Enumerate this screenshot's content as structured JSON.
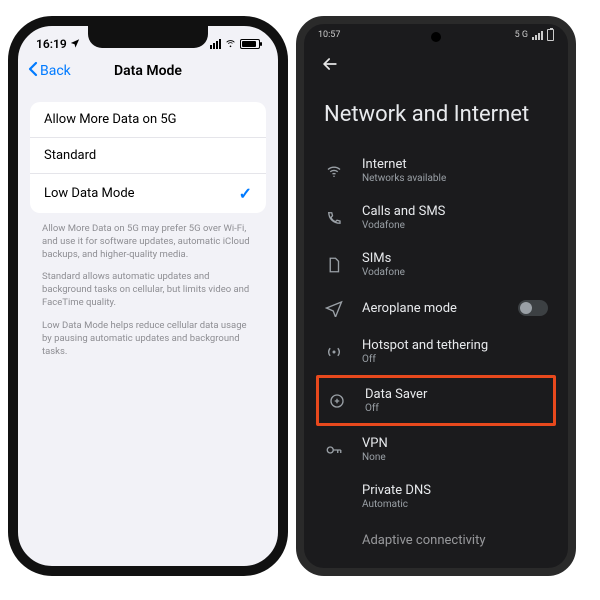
{
  "ios": {
    "status": {
      "time": "16:19"
    },
    "nav": {
      "back": "Back",
      "title": "Data Mode"
    },
    "options": [
      {
        "label": "Allow More Data on 5G",
        "selected": false
      },
      {
        "label": "Standard",
        "selected": false
      },
      {
        "label": "Low Data Mode",
        "selected": true
      }
    ],
    "desc1": "Allow More Data on 5G may prefer 5G over Wi-Fi, and use it for software updates, automatic iCloud backups, and higher-quality media.",
    "desc2": "Standard allows automatic updates and background tasks on cellular, but limits video and FaceTime quality.",
    "desc3": "Low Data Mode helps reduce cellular data usage by pausing automatic updates and background tasks."
  },
  "android": {
    "status": {
      "time": "10:57",
      "extras": "5 G"
    },
    "title": "Network and Internet",
    "items": [
      {
        "label": "Internet",
        "sub": "Networks available"
      },
      {
        "label": "Calls and SMS",
        "sub": "Vodafone"
      },
      {
        "label": "SIMs",
        "sub": "Vodafone"
      },
      {
        "label": "Aeroplane mode",
        "sub": "",
        "toggle": true
      },
      {
        "label": "Hotspot and tethering",
        "sub": "Off"
      },
      {
        "label": "Data Saver",
        "sub": "Off"
      },
      {
        "label": "VPN",
        "sub": "None"
      },
      {
        "label": "Private DNS",
        "sub": "Automatic"
      },
      {
        "label": "Adaptive connectivity",
        "sub": ""
      }
    ]
  }
}
